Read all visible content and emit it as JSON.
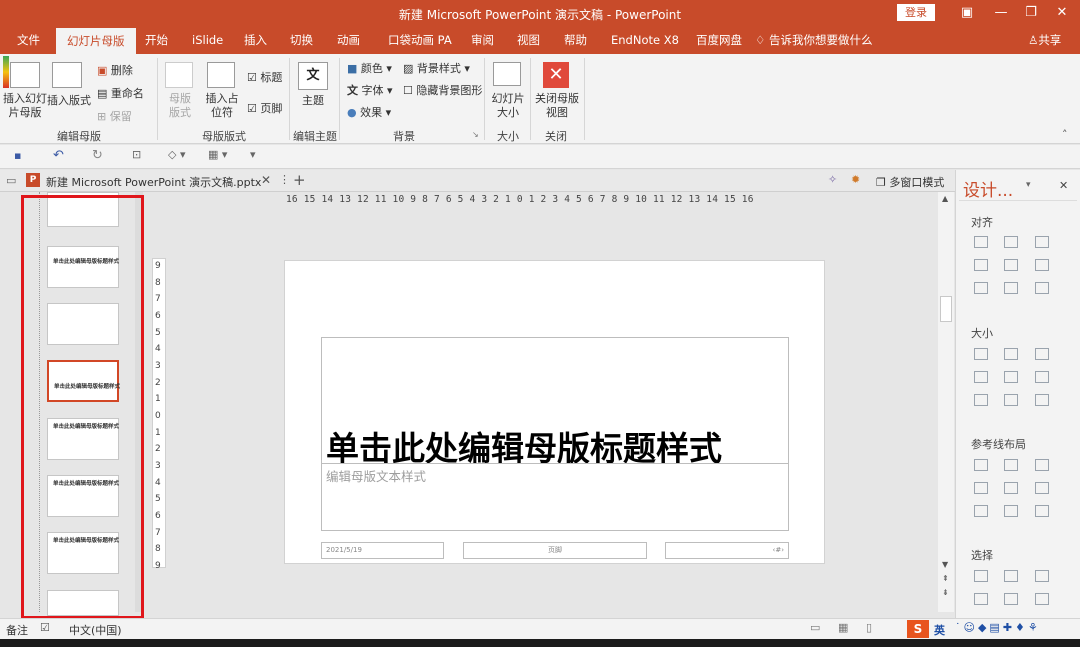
{
  "window": {
    "title": "新建 Microsoft PowerPoint 演示文稿 - PowerPoint",
    "login_label": "登录",
    "share_label": "共享"
  },
  "menu_tabs": [
    "文件",
    "幻灯片母版",
    "开始",
    "iSlide",
    "插入",
    "切换",
    "动画",
    "口袋动画 PA",
    "审阅",
    "视图",
    "帮助",
    "EndNote X8",
    "百度网盘"
  ],
  "tell_me": "告诉我你想要做什么",
  "ribbon": {
    "insert_slide_master": "插入幻灯片母版",
    "insert_layout": "插入版式",
    "delete": "删除",
    "rename": "重命名",
    "preserve": "保留",
    "group_edit_master": "编辑母版",
    "master_layout": "母版版式",
    "insert_placeholder": "插入占位符",
    "title_check": "标题",
    "footer_check": "页脚",
    "group_master_layout": "母版版式",
    "themes": "主题",
    "group_edit_theme": "编辑主题",
    "colors": "颜色",
    "fonts": "字体",
    "effects": "效果",
    "background_styles": "背景样式",
    "hide_background": "隐藏背景图形",
    "group_background": "背景",
    "slide_size": "幻灯片大小",
    "group_size": "大小",
    "close_master": "关闭母版视图",
    "group_close": "关闭"
  },
  "doc_tab": {
    "filename": "新建 Microsoft  PowerPoint 演示文稿.pptx",
    "multi_window": "多窗口模式"
  },
  "thumbnails": [
    {
      "label": ""
    },
    {
      "label": "单击此处编辑母版标题样式"
    },
    {
      "label": ""
    },
    {
      "label": "单击此处编辑母版标题样式"
    },
    {
      "label": "单击此处编辑母版标题样式"
    },
    {
      "label": "单击此处编辑母版标题样式"
    },
    {
      "label": "单击此处编辑母版标题样式"
    },
    {
      "label": ""
    }
  ],
  "ruler": {
    "horizontal": "16 15 14 13 12 11 10  9  8  7  6  5  4  3  2  1  0  1  2  3  4  5  6  7  8  9 10 11 12 13 14 15 16",
    "vertical": [
      "9",
      "8",
      "7",
      "6",
      "5",
      "4",
      "3",
      "2",
      "1",
      "0",
      "1",
      "2",
      "3",
      "4",
      "5",
      "6",
      "7",
      "8",
      "9"
    ]
  },
  "slide": {
    "title": "单击此处编辑母版标题样式",
    "subtitle": "编辑母版文本样式",
    "date": "2021/5/19",
    "footer": "页脚",
    "page_number": "‹#›"
  },
  "design_pane": {
    "title": "设计...",
    "align": "对齐",
    "size": "大小",
    "guides": "参考线布局",
    "select": "选择"
  },
  "status": {
    "notes": "备注",
    "language": "中文(中国)",
    "ime": "英"
  },
  "colors": {
    "accent": "#c84b2a",
    "selection": "#e0161b"
  }
}
